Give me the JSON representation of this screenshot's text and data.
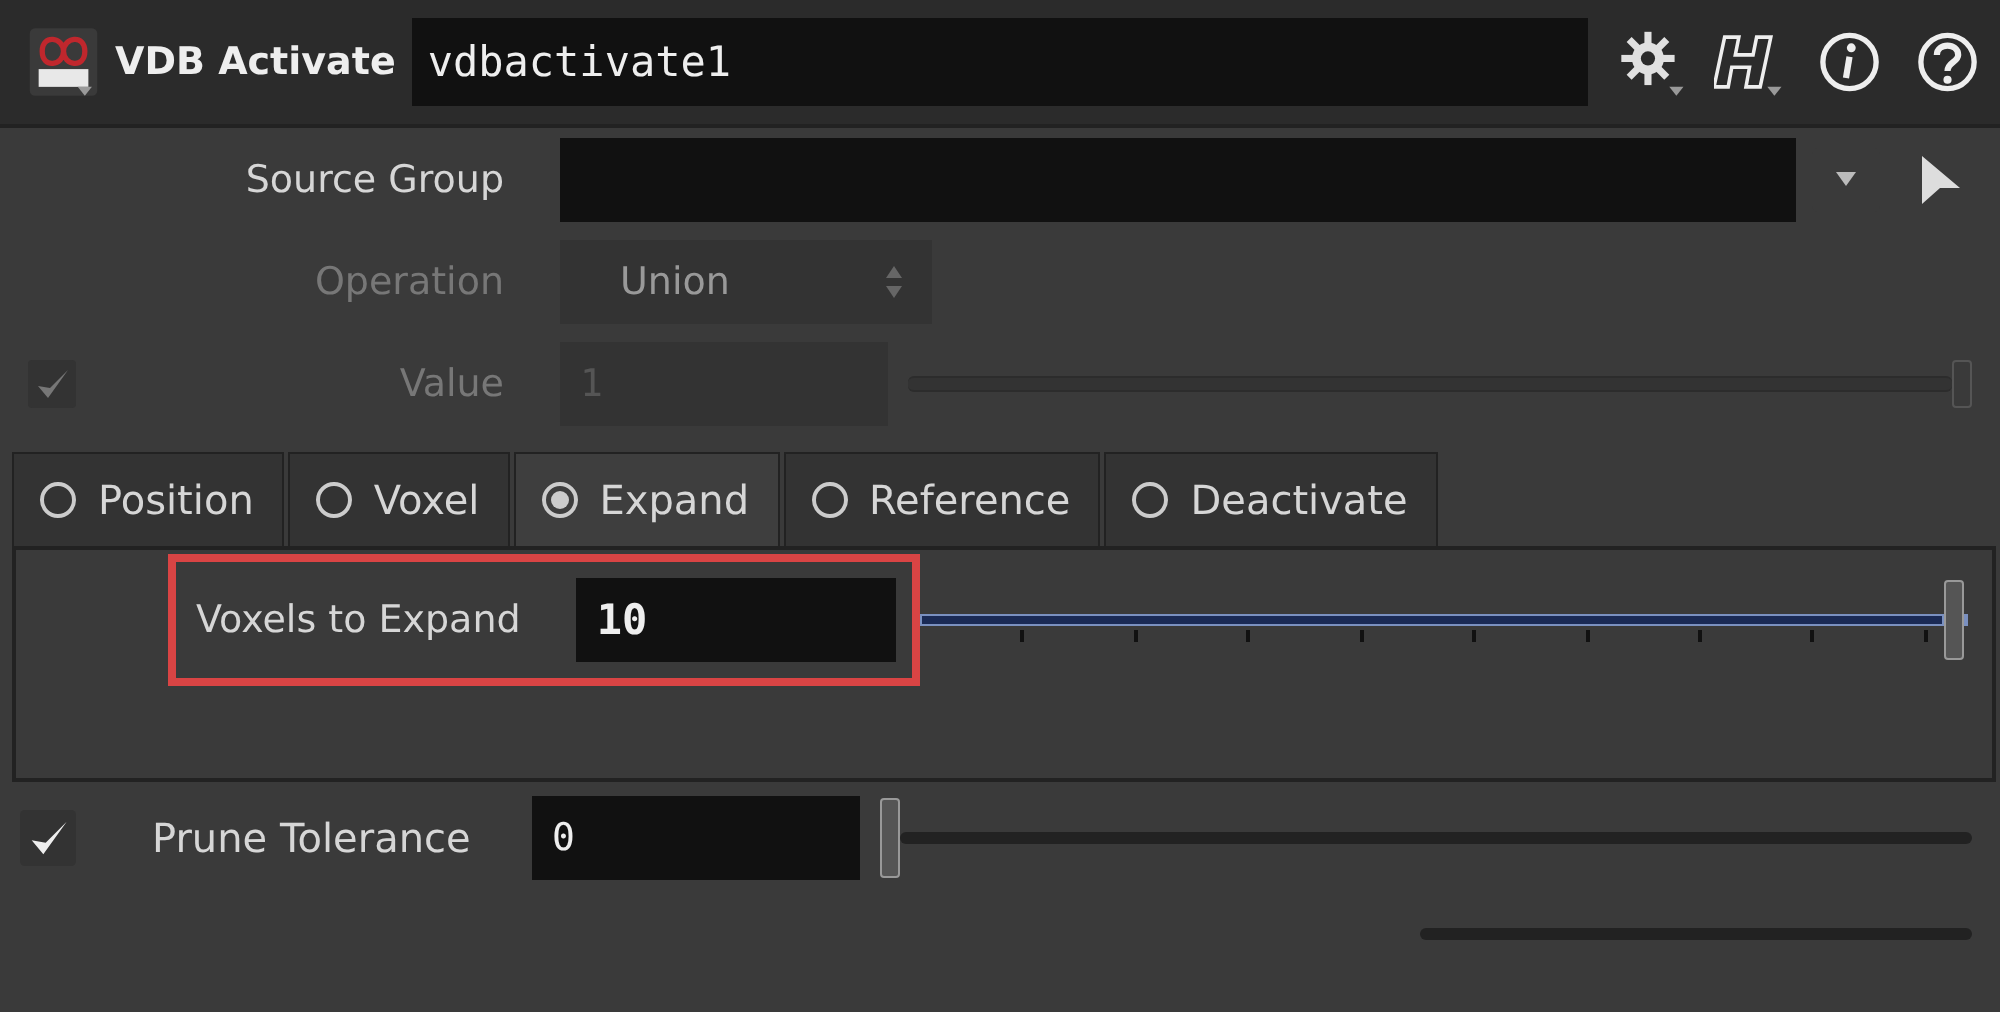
{
  "header": {
    "node_type": "VDB Activate",
    "node_name": "vdbactivate1"
  },
  "parameters": [
    {
      "kind": "group",
      "label": "Source Group",
      "disabled": false
    },
    {
      "kind": "menu",
      "label": "Operation",
      "value": "Union",
      "disabled": true
    },
    {
      "kind": "slider",
      "label": "Value",
      "value": "1",
      "level": 1,
      "checked": true,
      "disabled": true
    }
  ],
  "tabs": [
    {
      "label": "Position",
      "selected": false
    },
    {
      "label": "Voxel",
      "selected": false
    },
    {
      "label": "Expand",
      "selected": true
    },
    {
      "label": "Reference",
      "selected": false
    },
    {
      "label": "Deactivate",
      "selected": false
    }
  ],
  "tab_content": {
    "label": "Voxels to Expand",
    "value": "10",
    "level": 1,
    "highlighted": true
  },
  "prune": {
    "label": "Prune Tolerance",
    "value": "0",
    "level": 0,
    "checked": true,
    "disabled": false
  }
}
